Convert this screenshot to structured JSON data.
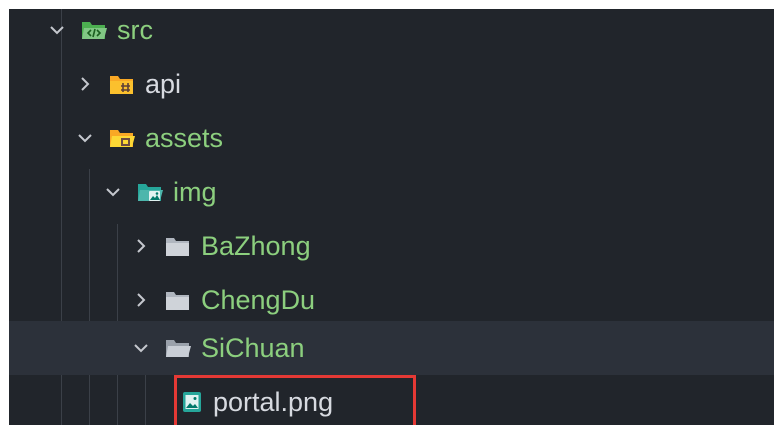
{
  "explorer": {
    "items": [
      {
        "label": "src",
        "expanded": true,
        "icon": "folder-src-open-icon"
      },
      {
        "label": "api",
        "expanded": false,
        "icon": "folder-api-icon"
      },
      {
        "label": "assets",
        "expanded": true,
        "icon": "folder-assets-open-icon"
      },
      {
        "label": "img",
        "expanded": true,
        "icon": "folder-images-open-icon"
      },
      {
        "label": "BaZhong",
        "expanded": false,
        "icon": "folder-icon"
      },
      {
        "label": "ChengDu",
        "expanded": false,
        "icon": "folder-icon"
      },
      {
        "label": "SiChuan",
        "expanded": true,
        "icon": "folder-open-icon"
      },
      {
        "label": "portal.png",
        "icon": "image-file-icon"
      }
    ]
  },
  "colors": {
    "background": "#21252b",
    "hover_row": "#2c313a",
    "highlight_border": "#e53935",
    "text_folder": "#d7dae0",
    "text_green": "#8ccf7e"
  }
}
